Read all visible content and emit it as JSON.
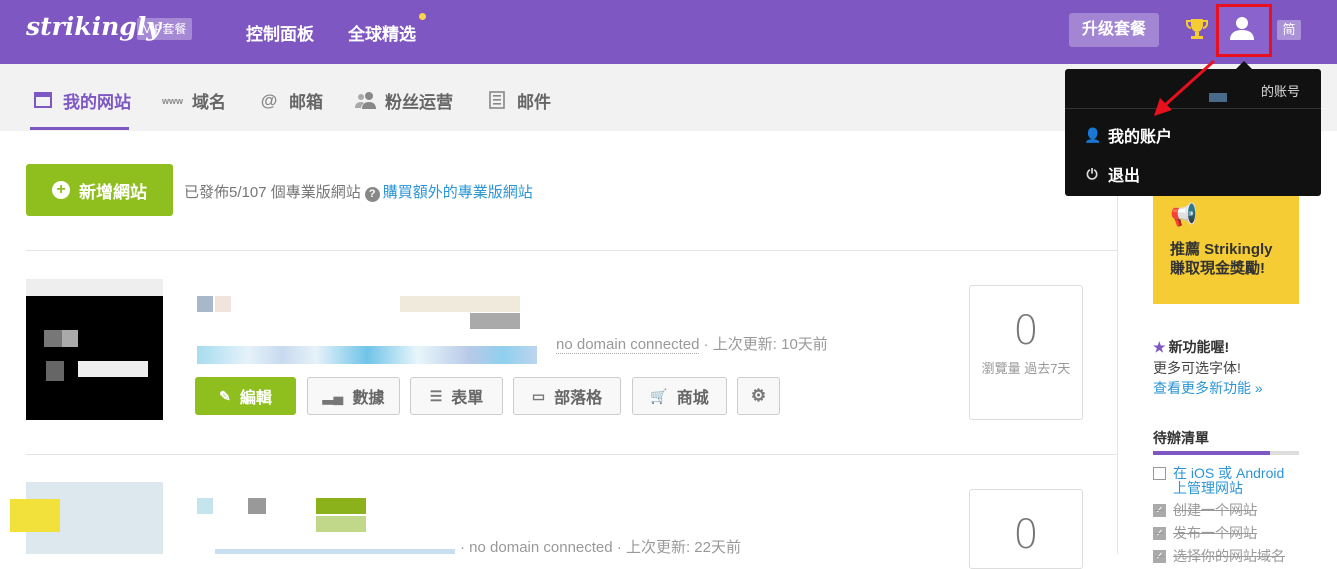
{
  "header": {
    "logo": "strikingly",
    "plan_badge": "VIP套餐",
    "nav": [
      "控制面板",
      "全球精选"
    ],
    "upgrade_label": "升级套餐",
    "lang_label": "简"
  },
  "subnav": {
    "tabs": [
      {
        "label": "我的网站",
        "icon": "browser-window-icon",
        "active": true
      },
      {
        "label": "域名",
        "icon": "www-icon",
        "active": false
      },
      {
        "label": "邮箱",
        "icon": "at-sign-icon",
        "active": false
      },
      {
        "label": "粉丝运营",
        "icon": "users-icon",
        "active": false
      },
      {
        "label": "邮件",
        "icon": "newsletter-icon",
        "active": false
      }
    ]
  },
  "toolbar": {
    "new_site_label": "新增網站",
    "published_info": "已發佈5/107 個專業版網站",
    "buy_link": "購買額外的專業版網站"
  },
  "sites": [
    {
      "domain_status": "no domain connected",
      "updated": "上次更新:  10天前",
      "views": "0",
      "views_label": "瀏覽量 過去7天",
      "buttons": [
        "編輯",
        "數據",
        "表單",
        "部落格",
        "商城"
      ]
    },
    {
      "domain_status": "no domain connected",
      "updated": "上次更新:  22天前",
      "views": "0"
    }
  ],
  "dropdown": {
    "account_suffix": "的账号",
    "items": [
      "我的账户",
      "退出"
    ]
  },
  "sidebar": {
    "promo": "推薦 Strikingly 賺取現金獎勵!",
    "promo_line1": "推薦 Strikingly",
    "promo_line2": "賺取現金獎勵!",
    "feature_title": "新功能喔!",
    "feature_desc": "更多可选字体!",
    "feature_link": "查看更多新功能 »",
    "todo_title": "待辦清單",
    "todo_progress": 0.8,
    "todos": [
      {
        "label": "在 iOS 或 Android 上管理网站",
        "line1": "在 iOS 或 Android",
        "line2": "上管理网站",
        "done": false
      },
      {
        "label": "创建一个网站",
        "done": true
      },
      {
        "label": "发布一个网站",
        "done": true
      },
      {
        "label": "选择你的网站域名",
        "done": true
      }
    ]
  },
  "colors": {
    "brand_purple": "#7e57c2",
    "green": "#8ebf1e",
    "link_blue": "#2b95d6",
    "promo_yellow": "#f5cc33",
    "highlight_red": "#e8101d"
  }
}
